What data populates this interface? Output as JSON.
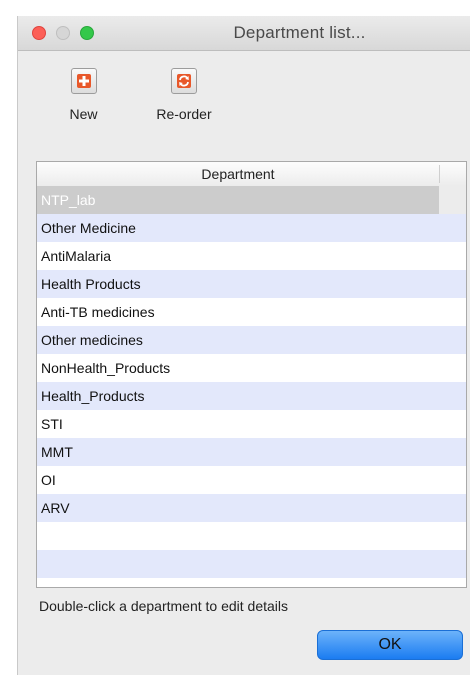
{
  "window": {
    "title": "Department list..."
  },
  "toolbar": {
    "new_label": "New",
    "reorder_label": "Re-order",
    "new_icon": "plus-icon",
    "reorder_icon": "reorder-icon"
  },
  "table": {
    "column_header": "Department",
    "selected_index": 0,
    "rows": [
      "NTP_lab",
      "Other Medicine",
      "AntiMalaria",
      "Health Products",
      "Anti-TB medicines",
      "Other medicines",
      "NonHealth_Products",
      "Health_Products",
      "STI",
      "MMT",
      "OI",
      "ARV",
      "",
      ""
    ]
  },
  "footer": {
    "hint": "Double-click a department to edit details",
    "ok_label": "OK"
  },
  "colors": {
    "accent": "#1b7cf1",
    "stripe": "#e3e8fb",
    "selection": "#cccccc",
    "icon_orange": "#e8582a"
  }
}
